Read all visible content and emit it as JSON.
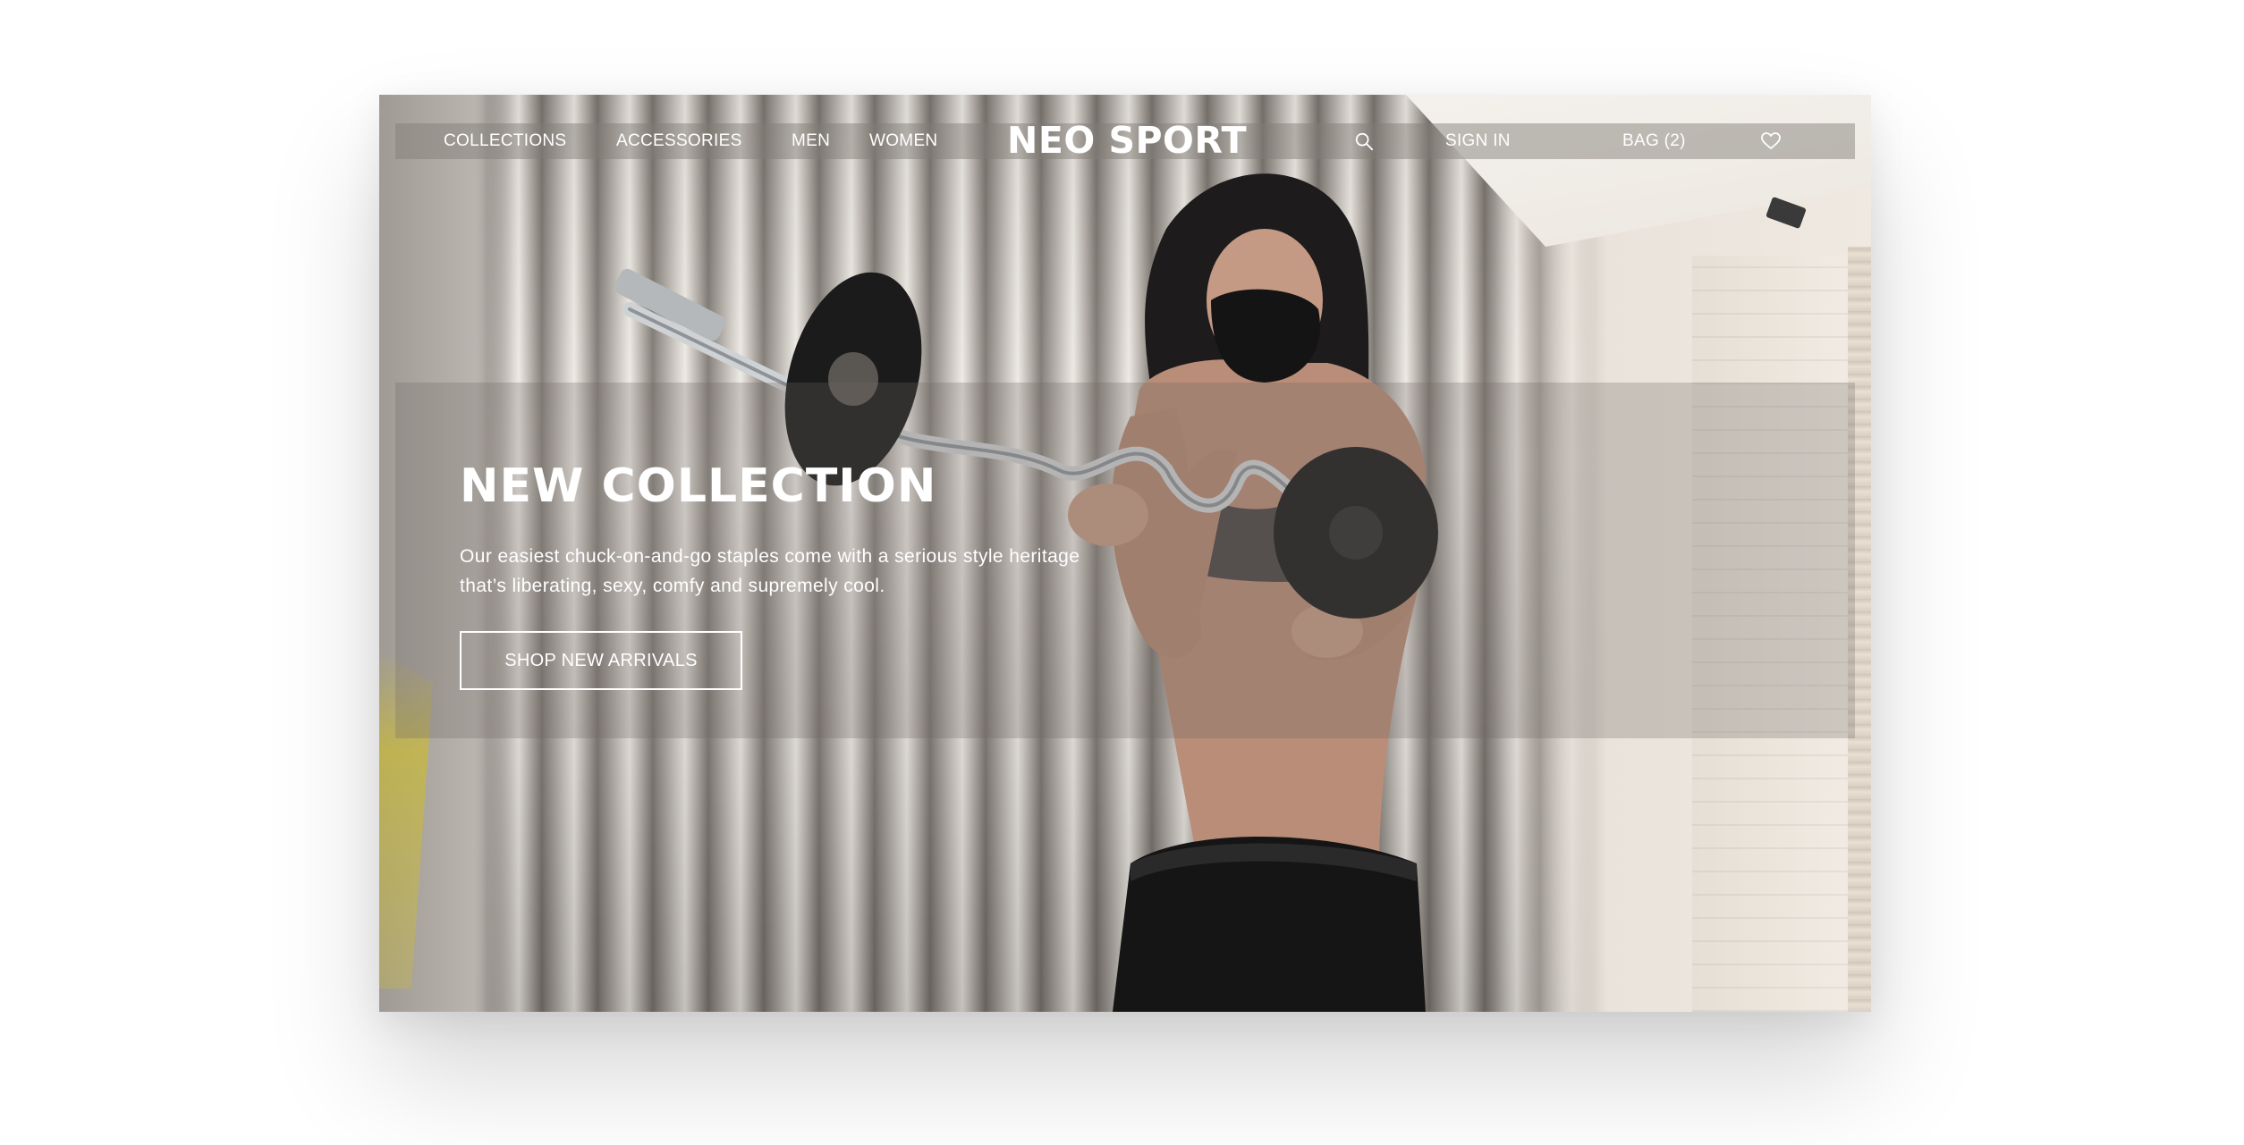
{
  "nav": {
    "collections": "COLLECTIONS",
    "accessories": "ACCESSORIES",
    "men": "MEN",
    "women": "WOMEN",
    "brand": "NEO SPORT",
    "search_icon": "search-icon",
    "sign_in": "SIGN IN",
    "bag": "BAG (2)",
    "wishlist_icon": "heart-icon"
  },
  "hero": {
    "title": "NEW COLLECTION",
    "description": "Our easiest chuck-on-and-go staples come with a serious style heritage that’s liberating, sexy, comfy and supremely cool.",
    "cta": "SHOP NEW ARRIVALS"
  },
  "colors": {
    "text": "#ffffff",
    "nav_overlay": "rgba(130,125,120,0.48)",
    "panel_overlay": "rgba(110,105,100,0.28)"
  }
}
